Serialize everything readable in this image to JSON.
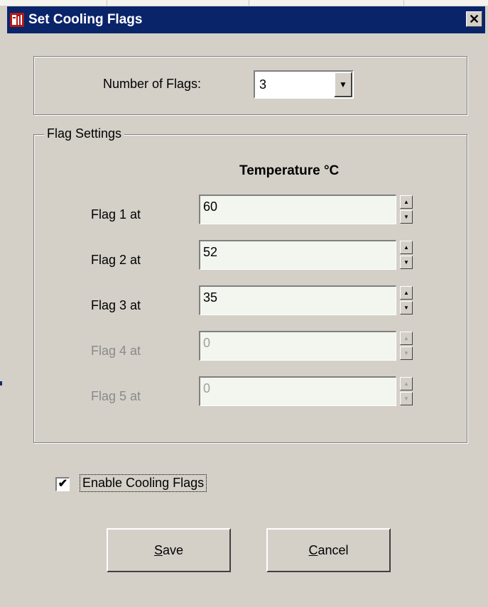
{
  "window": {
    "title": "Set Cooling Flags",
    "close_glyph": "✕"
  },
  "top": {
    "label": "Number of Flags:",
    "value": "3",
    "arrow": "▼"
  },
  "flag_settings": {
    "legend": "Flag Settings",
    "header": "Temperature  °C",
    "rows": [
      {
        "label": "Flag 1  at",
        "value": "60",
        "enabled": true
      },
      {
        "label": "Flag 2  at",
        "value": "52",
        "enabled": true
      },
      {
        "label": "Flag 3  at",
        "value": "35",
        "enabled": true
      },
      {
        "label": "Flag 4  at",
        "value": "0",
        "enabled": false
      },
      {
        "label": "Flag 5  at",
        "value": "0",
        "enabled": false
      }
    ],
    "spin_up": "▲",
    "spin_down": "▼"
  },
  "enable": {
    "checked": true,
    "check_glyph": "✔",
    "label": "Enable Cooling Flags"
  },
  "buttons": {
    "save_mnemonic": "S",
    "save_rest": "ave",
    "cancel_mnemonic": "C",
    "cancel_rest": "ancel"
  }
}
